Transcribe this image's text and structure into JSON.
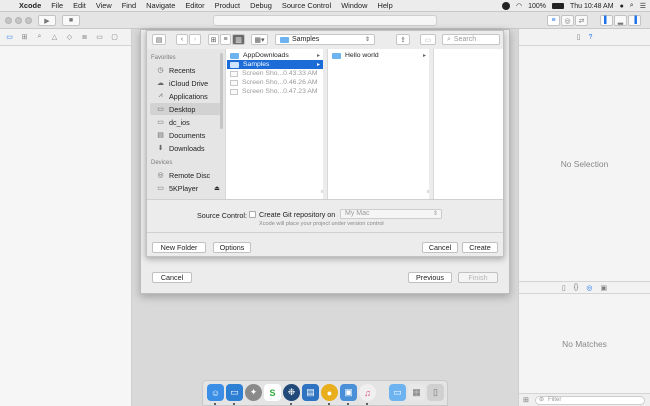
{
  "menubar": {
    "apple": "",
    "app_name": "Xcode",
    "items": [
      "File",
      "Edit",
      "View",
      "Find",
      "Navigate",
      "Editor",
      "Product",
      "Debug",
      "Source Control",
      "Window",
      "Help"
    ],
    "battery": "100%",
    "clock": "Thu 10:48 AM"
  },
  "toolbar": {
    "run_icon": "play-icon",
    "stop_icon": "stop-icon"
  },
  "inspector": {
    "no_selection": "No Selection"
  },
  "library": {
    "no_matches": "No Matches",
    "filter_placeholder": "Filter"
  },
  "sheet": {
    "cancel": "Cancel",
    "previous": "Previous",
    "finish": "Finish"
  },
  "save_panel": {
    "path_popup": "Samples",
    "search_placeholder": "Search",
    "sidebar": {
      "favorites_header": "Favorites",
      "favorites": [
        {
          "label": "Recents",
          "icon": "clock-icon"
        },
        {
          "label": "iCloud Drive",
          "icon": "cloud-icon"
        },
        {
          "label": "Applications",
          "icon": "applications-icon"
        },
        {
          "label": "Desktop",
          "icon": "desktop-icon"
        },
        {
          "label": "dc_ios",
          "icon": "folder-icon"
        },
        {
          "label": "Documents",
          "icon": "documents-icon"
        },
        {
          "label": "Downloads",
          "icon": "downloads-icon"
        }
      ],
      "devices_header": "Devices",
      "devices": [
        {
          "label": "Remote Disc",
          "icon": "disc-icon"
        },
        {
          "label": "5KPlayer",
          "icon": "drive-icon",
          "eject": "⏏"
        }
      ]
    },
    "column1": [
      {
        "label": "AppDownloads",
        "type": "folder"
      },
      {
        "label": "Samples",
        "type": "folder",
        "selected": true
      },
      {
        "label": "Screen Sho...0.43.33 AM",
        "type": "file"
      },
      {
        "label": "Screen Sho...0.46.26 AM",
        "type": "file"
      },
      {
        "label": "Screen Sho...0.47.23 AM",
        "type": "file"
      }
    ],
    "column2": [
      {
        "label": "Hello world",
        "type": "folder"
      }
    ],
    "source_control": {
      "label": "Source Control:",
      "checkbox_label": "Create Git repository on",
      "location": "My Mac",
      "note": "Xcode will place your project under version control"
    },
    "buttons": {
      "new_folder": "New Folder",
      "options": "Options",
      "cancel": "Cancel",
      "create": "Create"
    }
  },
  "dock": {
    "apps": [
      "finder",
      "folder",
      "launchpad",
      "sublime-text",
      "sourcetree",
      "files",
      "chrome",
      "preview",
      "itunes",
      "folder-2",
      "downloads-stack",
      "trash"
    ]
  }
}
